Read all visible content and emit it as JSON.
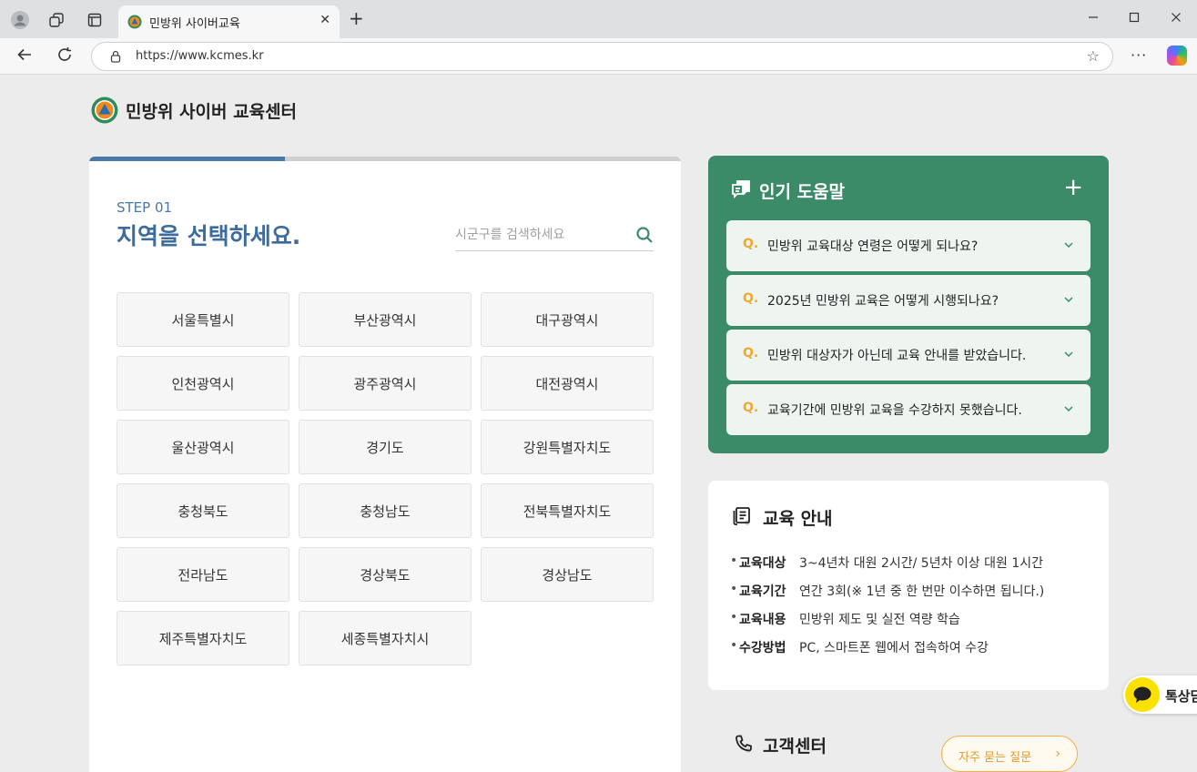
{
  "browser": {
    "tab_title": "민방위 사이버교육",
    "url": "https://www.kcmes.kr",
    "new_tab_label": "+",
    "close_tab_label": "✕",
    "more_label": "···"
  },
  "brand": {
    "title": "민방위 사이버 교육센터"
  },
  "step": {
    "label": "STEP 01",
    "title": "지역을 선택하세요.",
    "progress_fraction": 0.33,
    "search_placeholder": "시군구를 검색하세요"
  },
  "regions": [
    "서울특별시",
    "부산광역시",
    "대구광역시",
    "인천광역시",
    "광주광역시",
    "대전광역시",
    "울산광역시",
    "경기도",
    "강원특별자치도",
    "충청북도",
    "충청남도",
    "전북특별자치도",
    "전라남도",
    "경상북도",
    "경상남도",
    "제주특별자치도",
    "세종특별자치시"
  ],
  "help": {
    "title": "인기 도움말",
    "plus_label": "+",
    "q_marker": "Q.",
    "items": [
      "민방위 교육대상 연령은 어떻게 되나요?",
      "2025년 민방위 교육은 어떻게 시행되나요?",
      "민방위 대상자가 아닌데 교육 안내를 받았습니다.",
      "교육기간에 민방위 교육을 수강하지 못했습니다."
    ]
  },
  "info": {
    "title": "교육 안내",
    "bullet": "•",
    "rows": [
      {
        "label": "교육대상",
        "value": "3~4년차 대원 2시간/ 5년차 이상 대원 1시간"
      },
      {
        "label": "교육기간",
        "value": "연간 3회(※ 1년 중 한 번만 이수하면 됩니다.)"
      },
      {
        "label": "교육내용",
        "value": "민방위 제도 및 실전 역량 학습"
      },
      {
        "label": "수강방법",
        "value": "PC, 스마트폰 웹에서 접속하여 수강"
      }
    ]
  },
  "customer": {
    "title": "고객센터",
    "faq_button": "자주 묻는 질문",
    "faq_arrow": "›"
  },
  "kakao": {
    "label": "톡상담"
  },
  "colors": {
    "accent_blue": "#4a78a8",
    "help_green": "#3b8a68",
    "faq_orange": "#f0a830",
    "kakao_yellow": "#fae100"
  }
}
